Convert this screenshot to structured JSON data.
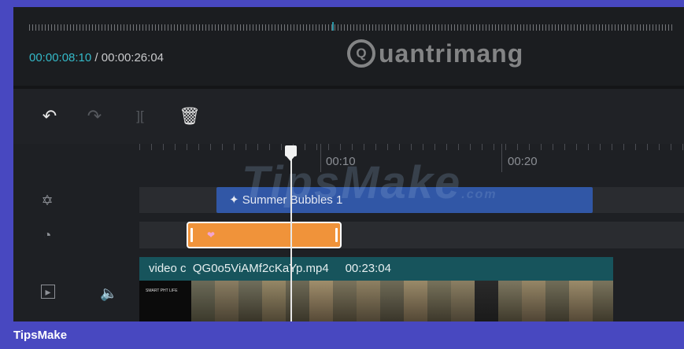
{
  "player": {
    "current_time": "00:00:08:10",
    "separator": " / ",
    "total_time": "00:00:26:04"
  },
  "watermarks": {
    "top_logo_mark": "Q",
    "top_logo_text": "uantrimang",
    "timeline_text": "TipsMake",
    "timeline_suffix": ".com"
  },
  "toolbar": {
    "icons": [
      "undo-icon",
      "redo-icon",
      "split-icon",
      "delete-icon"
    ]
  },
  "ruler": {
    "labels": [
      "00:10",
      "00:20"
    ]
  },
  "tracks": {
    "sticker": {
      "label": "Summer Bubbles 1",
      "icon": "sparkle-icon"
    },
    "effect": {
      "icon": "heart-icon",
      "color": "#f0933a"
    },
    "video": {
      "prefix": "video c",
      "filename": "QG0o5ViAMf2cKaYp.mp4",
      "duration": "00:23:04",
      "first_frame_text": "SMART PHT LIFE"
    }
  },
  "side_icons": [
    "sticker-track-icon",
    "effect-track-icon",
    "video-track-icon",
    "volume-icon"
  ],
  "footer": {
    "brand": "TipsMake"
  },
  "colors": {
    "accent": "#34b9c8",
    "sticker": "#3157a6",
    "video_head": "#17545c",
    "frame_border": "#4848c0"
  }
}
